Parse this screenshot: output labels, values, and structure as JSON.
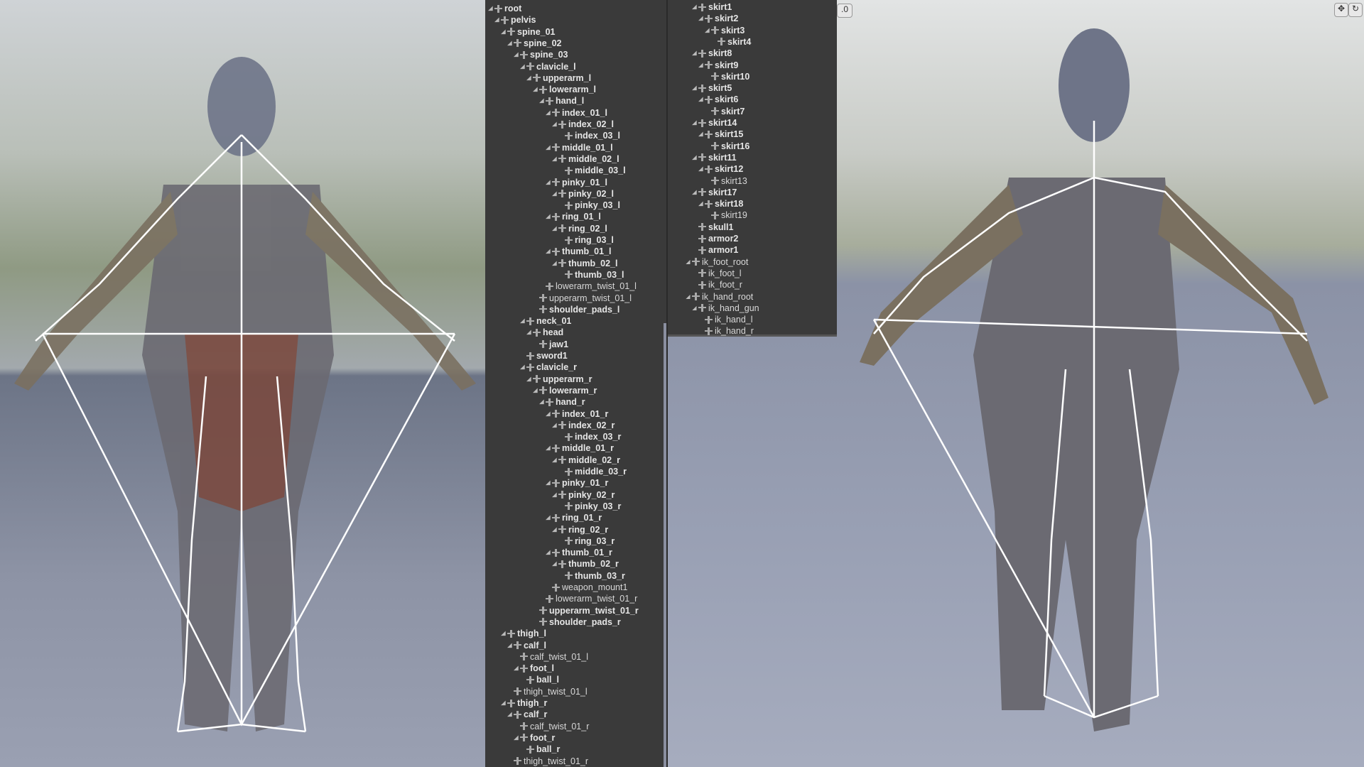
{
  "viewport_left": {
    "label": "left-viewport"
  },
  "viewport_right": {
    "speed_readout": ".0"
  },
  "colors": {
    "panel_bg": "#3a3a3a",
    "bone_line": "#ffffff"
  },
  "tree1": [
    {
      "label": "root",
      "d": 0,
      "e": true
    },
    {
      "label": "pelvis",
      "d": 1,
      "e": true
    },
    {
      "label": "spine_01",
      "d": 2,
      "e": true
    },
    {
      "label": "spine_02",
      "d": 3,
      "e": true
    },
    {
      "label": "spine_03",
      "d": 4,
      "e": true
    },
    {
      "label": "clavicle_l",
      "d": 5,
      "e": true
    },
    {
      "label": "upperarm_l",
      "d": 6,
      "e": true
    },
    {
      "label": "lowerarm_l",
      "d": 7,
      "e": true
    },
    {
      "label": "hand_l",
      "d": 8,
      "e": true
    },
    {
      "label": "index_01_l",
      "d": 9,
      "e": true
    },
    {
      "label": "index_02_l",
      "d": 10,
      "e": true
    },
    {
      "label": "index_03_l",
      "d": 11
    },
    {
      "label": "middle_01_l",
      "d": 9,
      "e": true
    },
    {
      "label": "middle_02_l",
      "d": 10,
      "e": true
    },
    {
      "label": "middle_03_l",
      "d": 11
    },
    {
      "label": "pinky_01_l",
      "d": 9,
      "e": true
    },
    {
      "label": "pinky_02_l",
      "d": 10,
      "e": true
    },
    {
      "label": "pinky_03_l",
      "d": 11
    },
    {
      "label": "ring_01_l",
      "d": 9,
      "e": true
    },
    {
      "label": "ring_02_l",
      "d": 10,
      "e": true
    },
    {
      "label": "ring_03_l",
      "d": 11
    },
    {
      "label": "thumb_01_l",
      "d": 9,
      "e": true
    },
    {
      "label": "thumb_02_l",
      "d": 10,
      "e": true
    },
    {
      "label": "thumb_03_l",
      "d": 11
    },
    {
      "label": "lowerarm_twist_01_l",
      "d": 8,
      "light": true
    },
    {
      "label": "upperarm_twist_01_l",
      "d": 7,
      "light": true
    },
    {
      "label": "shoulder_pads_l",
      "d": 7
    },
    {
      "label": "neck_01",
      "d": 5,
      "e": true
    },
    {
      "label": "head",
      "d": 6,
      "e": true
    },
    {
      "label": "jaw1",
      "d": 7
    },
    {
      "label": "sword1",
      "d": 5
    },
    {
      "label": "clavicle_r",
      "d": 5,
      "e": true
    },
    {
      "label": "upperarm_r",
      "d": 6,
      "e": true
    },
    {
      "label": "lowerarm_r",
      "d": 7,
      "e": true
    },
    {
      "label": "hand_r",
      "d": 8,
      "e": true
    },
    {
      "label": "index_01_r",
      "d": 9,
      "e": true
    },
    {
      "label": "index_02_r",
      "d": 10,
      "e": true
    },
    {
      "label": "index_03_r",
      "d": 11
    },
    {
      "label": "middle_01_r",
      "d": 9,
      "e": true
    },
    {
      "label": "middle_02_r",
      "d": 10,
      "e": true
    },
    {
      "label": "middle_03_r",
      "d": 11
    },
    {
      "label": "pinky_01_r",
      "d": 9,
      "e": true
    },
    {
      "label": "pinky_02_r",
      "d": 10,
      "e": true
    },
    {
      "label": "pinky_03_r",
      "d": 11
    },
    {
      "label": "ring_01_r",
      "d": 9,
      "e": true
    },
    {
      "label": "ring_02_r",
      "d": 10,
      "e": true
    },
    {
      "label": "ring_03_r",
      "d": 11
    },
    {
      "label": "thumb_01_r",
      "d": 9,
      "e": true
    },
    {
      "label": "thumb_02_r",
      "d": 10,
      "e": true
    },
    {
      "label": "thumb_03_r",
      "d": 11
    },
    {
      "label": "weapon_mount1",
      "d": 9,
      "light": true
    },
    {
      "label": "lowerarm_twist_01_r",
      "d": 8,
      "light": true
    },
    {
      "label": "upperarm_twist_01_r",
      "d": 7
    },
    {
      "label": "shoulder_pads_r",
      "d": 7
    },
    {
      "label": "thigh_l",
      "d": 2,
      "e": true
    },
    {
      "label": "calf_l",
      "d": 3,
      "e": true
    },
    {
      "label": "calf_twist_01_l",
      "d": 4,
      "light": true
    },
    {
      "label": "foot_l",
      "d": 4,
      "e": true
    },
    {
      "label": "ball_l",
      "d": 5
    },
    {
      "label": "thigh_twist_01_l",
      "d": 3,
      "light": true
    },
    {
      "label": "thigh_r",
      "d": 2,
      "e": true
    },
    {
      "label": "calf_r",
      "d": 3,
      "e": true
    },
    {
      "label": "calf_twist_01_r",
      "d": 4,
      "light": true
    },
    {
      "label": "foot_r",
      "d": 4,
      "e": true
    },
    {
      "label": "ball_r",
      "d": 5
    },
    {
      "label": "thigh_twist_01_r",
      "d": 3,
      "light": true
    }
  ],
  "tree2": [
    {
      "label": "skirt1",
      "d": 2,
      "e": true
    },
    {
      "label": "skirt2",
      "d": 3,
      "e": true
    },
    {
      "label": "skirt3",
      "d": 4,
      "e": true
    },
    {
      "label": "skirt4",
      "d": 5
    },
    {
      "label": "skirt8",
      "d": 2,
      "e": true
    },
    {
      "label": "skirt9",
      "d": 3,
      "e": true
    },
    {
      "label": "skirt10",
      "d": 4
    },
    {
      "label": "skirt5",
      "d": 2,
      "e": true
    },
    {
      "label": "skirt6",
      "d": 3,
      "e": true
    },
    {
      "label": "skirt7",
      "d": 4
    },
    {
      "label": "skirt14",
      "d": 2,
      "e": true
    },
    {
      "label": "skirt15",
      "d": 3,
      "e": true
    },
    {
      "label": "skirt16",
      "d": 4
    },
    {
      "label": "skirt11",
      "d": 2,
      "e": true
    },
    {
      "label": "skirt12",
      "d": 3,
      "e": true
    },
    {
      "label": "skirt13",
      "d": 4,
      "light": true
    },
    {
      "label": "skirt17",
      "d": 2,
      "e": true
    },
    {
      "label": "skirt18",
      "d": 3,
      "e": true
    },
    {
      "label": "skirt19",
      "d": 4,
      "light": true
    },
    {
      "label": "skull1",
      "d": 2
    },
    {
      "label": "armor2",
      "d": 2
    },
    {
      "label": "armor1",
      "d": 2
    },
    {
      "label": "ik_foot_root",
      "d": 1,
      "e": true,
      "light": true
    },
    {
      "label": "ik_foot_l",
      "d": 2,
      "light": true
    },
    {
      "label": "ik_foot_r",
      "d": 2,
      "light": true
    },
    {
      "label": "ik_hand_root",
      "d": 1,
      "e": true,
      "light": true
    },
    {
      "label": "ik_hand_gun",
      "d": 2,
      "e": true,
      "light": true
    },
    {
      "label": "ik_hand_l",
      "d": 3,
      "light": true
    },
    {
      "label": "ik_hand_r",
      "d": 3,
      "light": true
    }
  ]
}
